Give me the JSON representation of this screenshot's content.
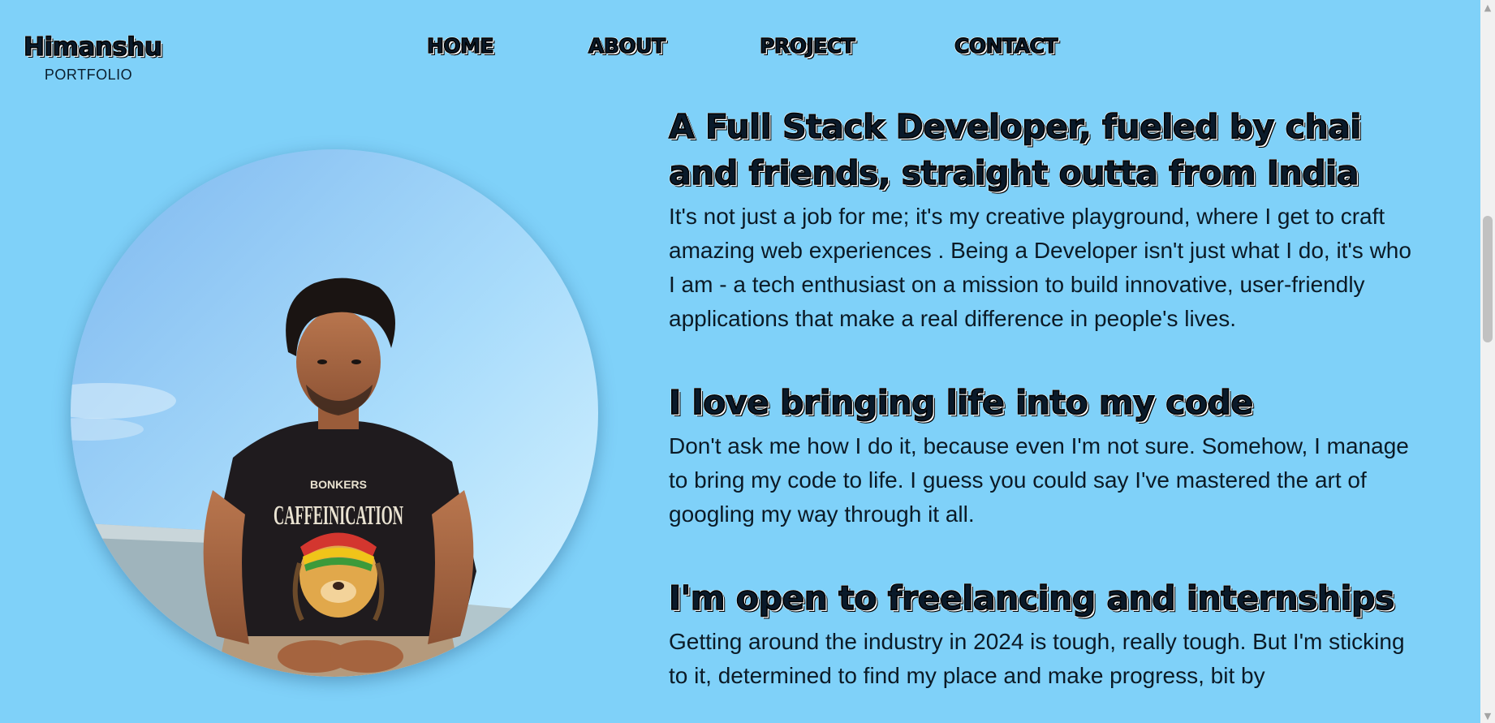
{
  "brand": {
    "name": "Himanshu",
    "subtitle": "PORTFOLIO"
  },
  "nav": {
    "items": [
      {
        "label": "HOME"
      },
      {
        "label": "ABOUT"
      },
      {
        "label": "PROJECT"
      },
      {
        "label": "CONTACT"
      }
    ]
  },
  "photo": {
    "shirt_brand": "BONKERS",
    "shirt_text": "CAFFEINICATION"
  },
  "sections": [
    {
      "heading": "A Full Stack Developer, fueled by chai and friends, straight outta from India",
      "body": "It's not just a job for me; it's my creative playground, where I get to craft amazing web experiences . Being a Developer isn't just what I do, it's who I am - a tech enthusiast on a mission to build innovative, user-friendly applications that make a real difference in people's lives."
    },
    {
      "heading": "I love bringing life into my code",
      "body": "Don't ask me how I do it, because even I'm not sure. Somehow, I manage to bring my code to life. I guess you could say I've mastered the art of googling my way through it all."
    },
    {
      "heading": "I'm open to freelancing and internships",
      "body": "Getting around the industry in 2024 is tough, really tough. But I'm sticking to it, determined to find my place and make progress, bit by"
    }
  ],
  "colors": {
    "background": "#7fd1f9",
    "text": "#0b1a26",
    "scrollbar_track": "#f1f1f1",
    "scrollbar_thumb": "#c1c1c1"
  },
  "icons": {
    "scroll_up": "triangle-up",
    "scroll_down": "triangle-down"
  }
}
